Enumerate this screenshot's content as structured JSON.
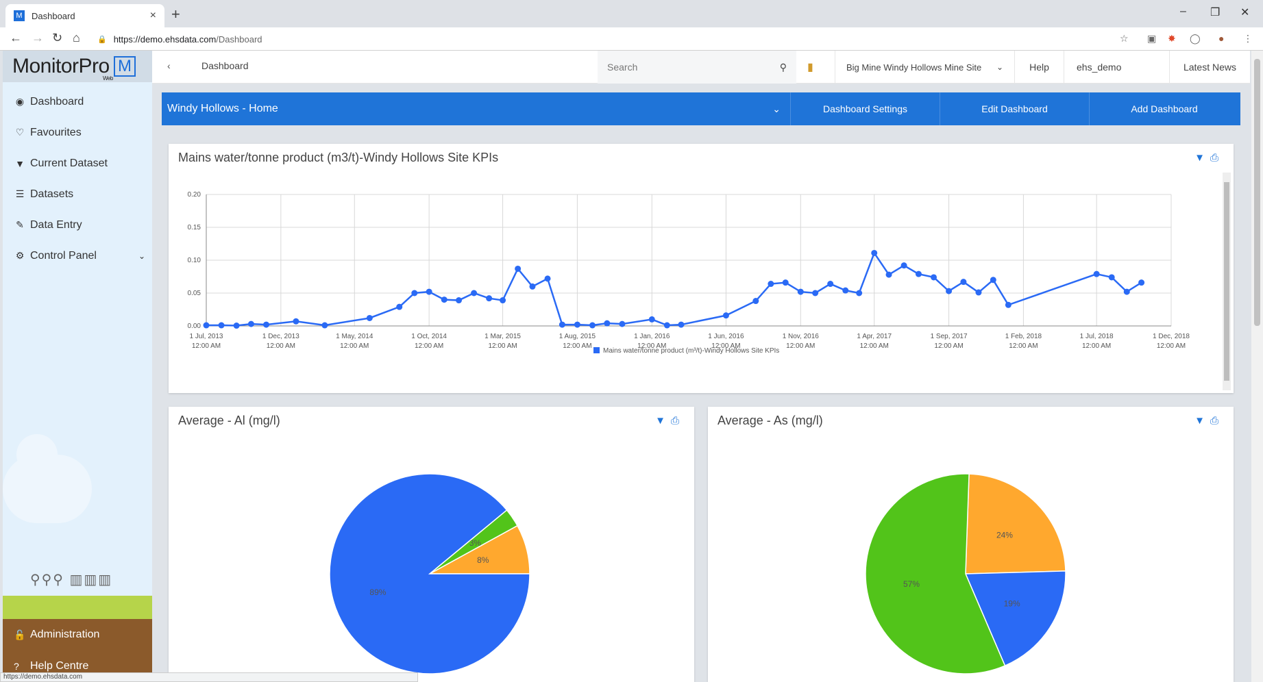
{
  "browser": {
    "tab_title": "Dashboard",
    "tab_close": "×",
    "new_tab": "+",
    "url_host": "https://demo.ehsdata.com",
    "url_path": "/Dashboard",
    "status_url": "https://demo.ehsdata.com",
    "win_min": "–",
    "win_restore": "❐",
    "win_close": "✕"
  },
  "sidebar": {
    "logo": "MonitorPro",
    "logo_sub": "Web",
    "items": [
      {
        "label": "Dashboard",
        "icon": "dashboard-icon",
        "glyph": "◉"
      },
      {
        "label": "Favourites",
        "icon": "heart-icon",
        "glyph": "♡"
      },
      {
        "label": "Current Dataset",
        "icon": "filter-icon",
        "glyph": "▼"
      },
      {
        "label": "Datasets",
        "icon": "list-icon",
        "glyph": "☰"
      },
      {
        "label": "Data Entry",
        "icon": "edit-icon",
        "glyph": "✎"
      },
      {
        "label": "Control Panel",
        "icon": "cogs-icon",
        "glyph": "⚙"
      }
    ],
    "admin": "Administration",
    "help": "Help Centre"
  },
  "topbar": {
    "crumb": "Dashboard",
    "search_placeholder": "Search",
    "site": "Big Mine Windy Hollows Mine Site",
    "help": "Help",
    "user": "ehs_demo",
    "news": "Latest News"
  },
  "dashbar": {
    "title": "Windy Hollows - Home",
    "settings": "Dashboard Settings",
    "edit": "Edit Dashboard",
    "add": "Add Dashboard"
  },
  "panels": {
    "line_title": "Mains water/tonne product (m3/t)-Windy Hollows Site KPIs",
    "pie1_title": "Average - Al (mg/l)",
    "pie2_title": "Average - As (mg/l)"
  },
  "colors": {
    "blue": "#2a6af5",
    "green": "#52c41a",
    "orange": "#ffa82e"
  },
  "chart_data": [
    {
      "type": "line",
      "title": "",
      "xlabel": "",
      "ylabel": "",
      "ylim": [
        0,
        0.2
      ],
      "yticks": [
        "0.00",
        "0.05",
        "0.10",
        "0.15",
        "0.20"
      ],
      "xtick_dates": [
        "1 Jul, 2013",
        "1 Dec, 2013",
        "1 May, 2014",
        "1 Oct, 2014",
        "1 Mar, 2015",
        "1 Aug, 2015",
        "1 Jan, 2016",
        "1 Jun, 2016",
        "1 Nov, 2016",
        "1 Apr, 2017",
        "1 Sep, 2017",
        "1 Feb, 2018",
        "1 Jul, 2018",
        "1 Dec, 2018"
      ],
      "xtick_time": "12:00 AM",
      "legend": "top-right",
      "series": [
        {
          "name": "Mains water/tonne product (m³/t)-Windy Hollows Site KPIs",
          "points": [
            [
              "2013-07-01",
              0.001
            ],
            [
              "2013-08-01",
              0.001
            ],
            [
              "2013-09-01",
              0.0005
            ],
            [
              "2013-10-01",
              0.003
            ],
            [
              "2013-11-01",
              0.002
            ],
            [
              "2014-01-01",
              0.007
            ],
            [
              "2014-03-01",
              0.001
            ],
            [
              "2014-06-01",
              0.012
            ],
            [
              "2014-08-01",
              0.029
            ],
            [
              "2014-09-01",
              0.05
            ],
            [
              "2014-10-01",
              0.052
            ],
            [
              "2014-11-01",
              0.04
            ],
            [
              "2014-12-01",
              0.039
            ],
            [
              "2015-01-01",
              0.05
            ],
            [
              "2015-02-01",
              0.042
            ],
            [
              "2015-03-01",
              0.039
            ],
            [
              "2015-04-01",
              0.087
            ],
            [
              "2015-05-01",
              0.06
            ],
            [
              "2015-06-01",
              0.072
            ],
            [
              "2015-07-01",
              0.002
            ],
            [
              "2015-08-01",
              0.002
            ],
            [
              "2015-09-01",
              0.001
            ],
            [
              "2015-10-01",
              0.004
            ],
            [
              "2015-11-01",
              0.003
            ],
            [
              "2016-01-01",
              0.01
            ],
            [
              "2016-02-01",
              0.001
            ],
            [
              "2016-03-01",
              0.002
            ],
            [
              "2016-06-01",
              0.016
            ],
            [
              "2016-08-01",
              0.038
            ],
            [
              "2016-09-01",
              0.064
            ],
            [
              "2016-10-01",
              0.066
            ],
            [
              "2016-11-01",
              0.052
            ],
            [
              "2016-12-01",
              0.05
            ],
            [
              "2017-01-01",
              0.064
            ],
            [
              "2017-02-01",
              0.054
            ],
            [
              "2017-03-01",
              0.05
            ],
            [
              "2017-04-01",
              0.111
            ],
            [
              "2017-05-01",
              0.078
            ],
            [
              "2017-06-01",
              0.092
            ],
            [
              "2017-07-01",
              0.079
            ],
            [
              "2017-08-01",
              0.074
            ],
            [
              "2017-09-01",
              0.053
            ],
            [
              "2017-10-01",
              0.067
            ],
            [
              "2017-11-01",
              0.051
            ],
            [
              "2017-12-01",
              0.07
            ],
            [
              "2018-01-01",
              0.032
            ],
            [
              "2018-07-01",
              0.079
            ],
            [
              "2018-08-01",
              0.074
            ],
            [
              "2018-09-01",
              0.052
            ],
            [
              "2018-10-01",
              0.066
            ]
          ]
        }
      ]
    },
    {
      "type": "pie",
      "title": "Average - Al (mg/l)",
      "slices": [
        {
          "label": "89%",
          "value": 89,
          "color": "#2a6af5"
        },
        {
          "label": "3%",
          "value": 3,
          "color": "#52c41a"
        },
        {
          "label": "8%",
          "value": 8,
          "color": "#ffa82e"
        }
      ]
    },
    {
      "type": "pie",
      "title": "Average - As (mg/l)",
      "slices": [
        {
          "label": "24%",
          "value": 24,
          "color": "#ffa82e"
        },
        {
          "label": "19%",
          "value": 19,
          "color": "#2a6af5"
        },
        {
          "label": "57%",
          "value": 57,
          "color": "#52c41a"
        }
      ]
    }
  ]
}
